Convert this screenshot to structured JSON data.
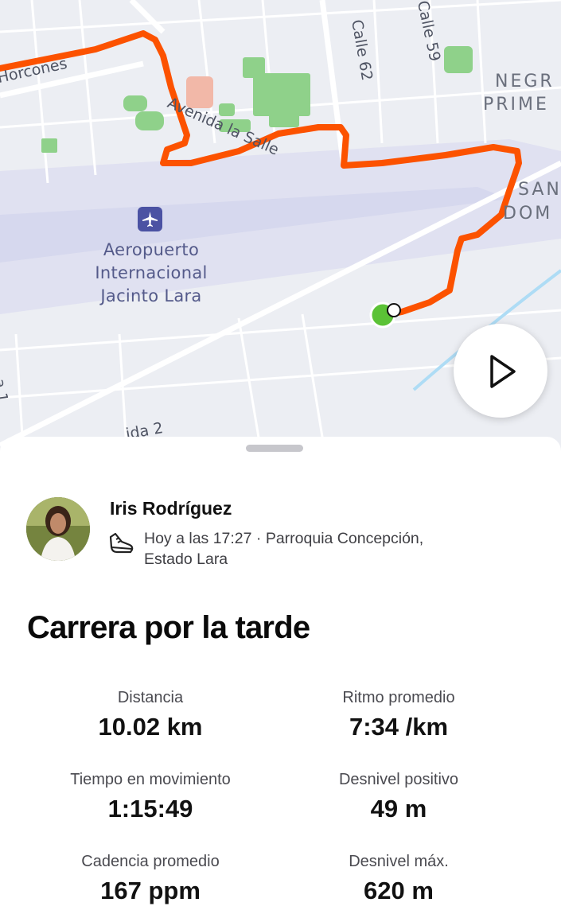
{
  "map": {
    "airport_name_lines": [
      "Aeropuerto",
      "Internacional",
      "Jacinto Lara"
    ],
    "street_labels": [
      "Horcones",
      "Avenida la Salle",
      "Calle 62",
      "Calle 59",
      "ida 2",
      "a 1"
    ],
    "place_labels": [
      "NEGR",
      "PRIME",
      "SAN",
      "DOM"
    ],
    "route_color": "#fc5200",
    "start_marker_color": "#5bc236"
  },
  "athlete": {
    "name": "Iris Rodríguez",
    "meta_line1": "Hoy a las 17:27 · Parroquia Concepción,",
    "meta_line2": "Estado Lara",
    "activity_icon": "running-shoe-icon"
  },
  "activity": {
    "title": "Carrera por la tarde"
  },
  "stats": [
    {
      "label": "Distancia",
      "value": "10.02 km"
    },
    {
      "label": "Ritmo promedio",
      "value": "7:34 /km"
    },
    {
      "label": "Tiempo en movimiento",
      "value": "1:15:49"
    },
    {
      "label": "Desnivel positivo",
      "value": "49 m"
    },
    {
      "label": "Cadencia promedio",
      "value": "167 ppm"
    },
    {
      "label": "Desnivel máx.",
      "value": "620 m"
    }
  ]
}
